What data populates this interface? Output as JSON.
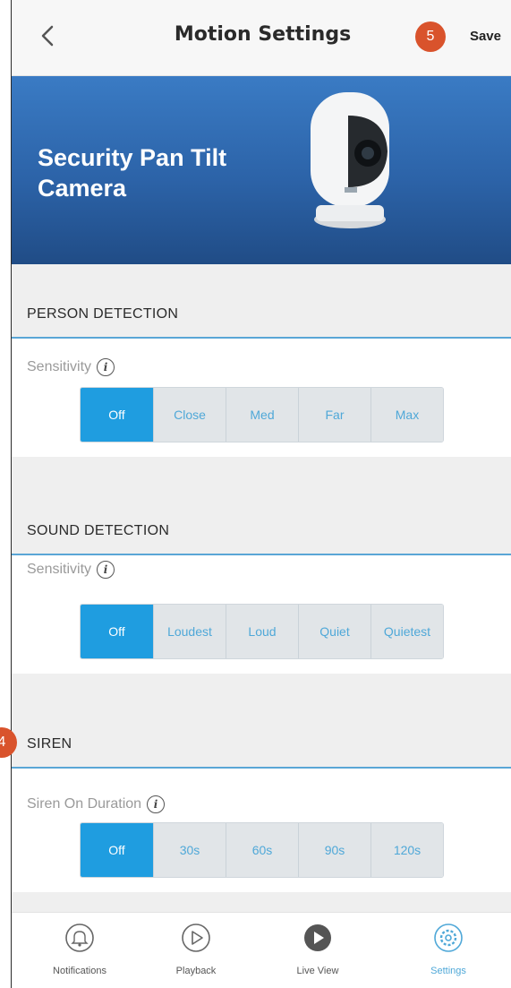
{
  "header": {
    "title": "Motion Settings",
    "save_label": "Save",
    "back_icon": "chevron-left-icon"
  },
  "callouts": {
    "save_step": "5",
    "siren_step": "4"
  },
  "banner": {
    "title": "Security Pan Tilt Camera",
    "image": "camera-image"
  },
  "person_detection": {
    "heading": "PERSON DETECTION",
    "field_label": "Sensitivity",
    "options": [
      "Off",
      "Close",
      "Med",
      "Far",
      "Max"
    ],
    "selected": "Off"
  },
  "sound_detection": {
    "heading": "SOUND DETECTION",
    "field_label": "Sensitivity",
    "options": [
      "Off",
      "Loudest",
      "Loud",
      "Quiet",
      "Quietest"
    ],
    "selected": "Off"
  },
  "siren": {
    "heading": "SIREN",
    "field_label": "Siren On Duration",
    "options": [
      "Off",
      "30s",
      "60s",
      "90s",
      "120s"
    ],
    "selected": "Off"
  },
  "tabs": [
    {
      "label": "Notifications",
      "icon": "bell-icon",
      "active": false
    },
    {
      "label": "Playback",
      "icon": "play-outline-icon",
      "active": false
    },
    {
      "label": "Live View",
      "icon": "play-filled-icon",
      "active": false
    },
    {
      "label": "Settings",
      "icon": "gear-icon",
      "active": true
    }
  ],
  "colors": {
    "accent": "#1f9de0",
    "banner": "#2c63a8",
    "callout": "#d9532c"
  }
}
